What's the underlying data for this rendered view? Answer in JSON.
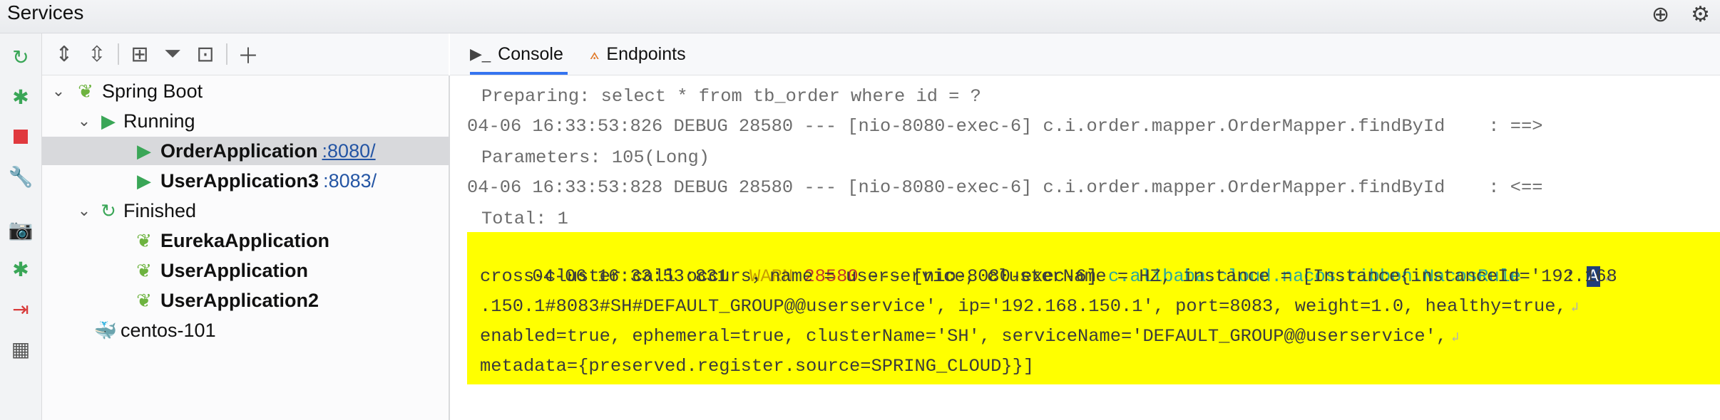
{
  "window": {
    "title": "Services"
  },
  "title_icons": [
    "crosshair-icon",
    "gear-icon"
  ],
  "left_toolbar": [
    "rerun-icon",
    "debug-attach-icon",
    "stop-icon",
    "wrench-icon",
    "camera-icon",
    "debug-icon",
    "login-icon",
    "layout-icon"
  ],
  "tree_toolbar": [
    "expand-all-icon",
    "collapse-all-icon",
    "group-icon",
    "filter-icon",
    "new-tab-icon",
    "add-icon"
  ],
  "tree": {
    "spring_boot": "Spring Boot",
    "running": "Running",
    "order_app": "OrderApplication",
    "order_port": ":8080/",
    "user_app3": "UserApplication3",
    "user_app3_port": ":8083/",
    "finished": "Finished",
    "eureka_app": "EurekaApplication",
    "user_app": "UserApplication",
    "user_app2": "UserApplication2",
    "centos": "centos-101"
  },
  "tabs": {
    "console": "Console",
    "endpoints": "Endpoints"
  },
  "console": {
    "line1": "Preparing: select * from tb_order where id = ?",
    "line2": "04-06 16:33:53:826 DEBUG 28580 --- [nio-8080-exec-6] c.i.order.mapper.OrderMapper.findById    : ==>",
    "line3": "Parameters: 105(Long)",
    "line4": "04-06 16:33:53:828 DEBUG 28580 --- [nio-8080-exec-6] c.i.order.mapper.OrderMapper.findById    : <==",
    "line5": "Total: 1",
    "warn_ts": "04-06 16:33:53:831",
    "warn_level": "WARN",
    "warn_pid": "28580",
    "warn_thread": "--- [nio-8080-exec-6]",
    "warn_logger": "c.alibaba.cloud.nacos.ribbon.NacosRule",
    "warn_sep": ":",
    "warn_caret": "A",
    "w1": "cross-cluster call occurs，name = userservice, clusterName = HZ, instance = [Instance{instanceId='192.168",
    "w2": ".150.1#8083#SH#DEFAULT_GROUP@@userservice', ip='192.168.150.1', port=8083, weight=1.0, healthy=true,",
    "w3": "enabled=true, ephemeral=true, clusterName='SH', serviceName='DEFAULT_GROUP@@userservice',",
    "w4": "metadata={preserved.register.source=SPRING_CLOUD}}]"
  },
  "colors": {
    "accent": "#3574f0",
    "highlight": "#ffff00",
    "run_green": "#4caf50",
    "stop_red": "#e0393e"
  }
}
